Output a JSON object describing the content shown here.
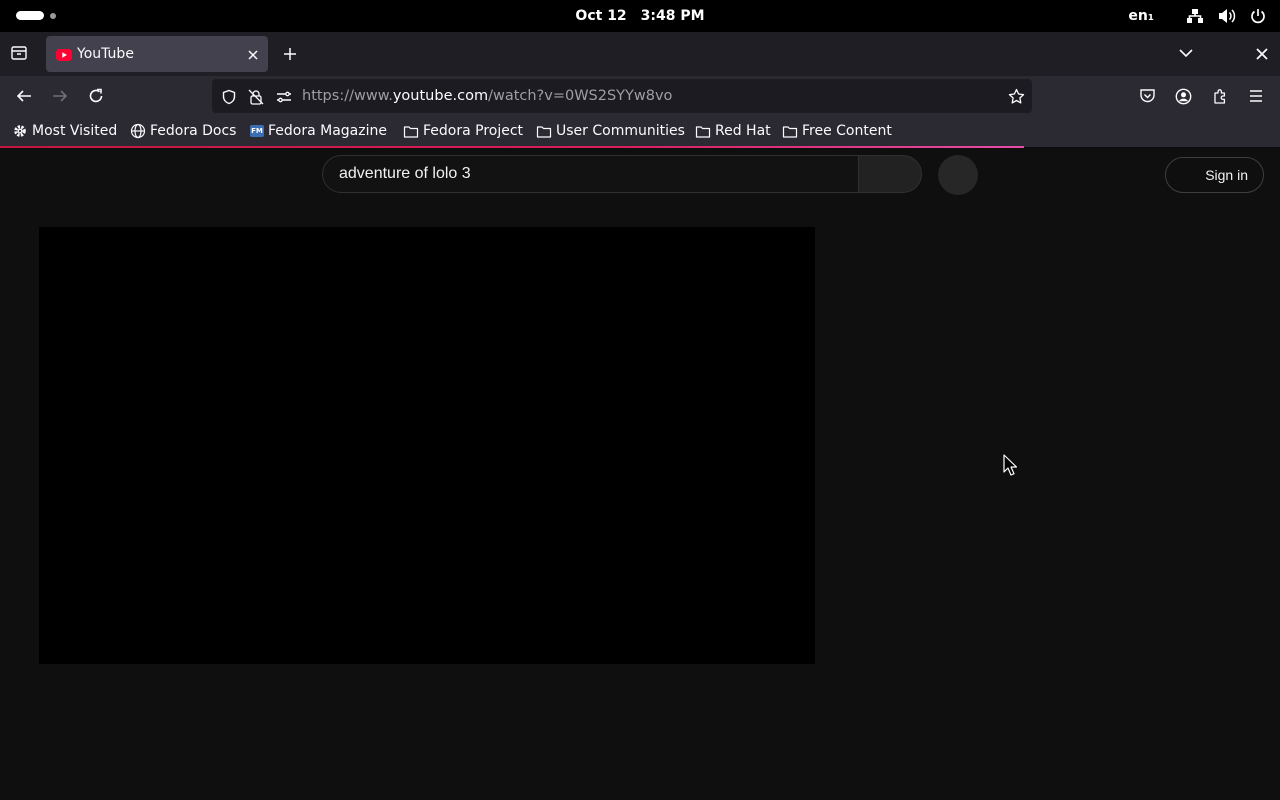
{
  "system_bar": {
    "date": "Oct 12",
    "time": "3:48 PM",
    "keyboard_layout": "en₁",
    "icons": [
      "network-icon",
      "volume-icon",
      "power-icon"
    ]
  },
  "browser": {
    "tab": {
      "title": "YouTube",
      "favicon": "youtube-icon"
    },
    "url": {
      "scheme": "https://www.",
      "host": "youtube.com",
      "path": "/watch?v=0WS2SYYw8vo"
    },
    "bookmarks": [
      {
        "label": "Most Visited",
        "icon": "gear-icon"
      },
      {
        "label": "Fedora Docs",
        "icon": "globe-icon"
      },
      {
        "label": "Fedora Magazine",
        "icon": "fedora-magazine-icon",
        "badge": "FM"
      },
      {
        "label": "Fedora Project",
        "icon": "folder-icon"
      },
      {
        "label": "User Communities",
        "icon": "folder-icon"
      },
      {
        "label": "Red Hat",
        "icon": "folder-icon"
      },
      {
        "label": "Free Content",
        "icon": "folder-icon"
      }
    ]
  },
  "youtube": {
    "search_query": "adventure of lolo 3",
    "sign_in_label": "Sign in"
  },
  "colors": {
    "page_background": "#0f0f0f",
    "video_background": "#000000",
    "loading_bar": "#d91d5e",
    "url_bar": "#1c1b22",
    "toolbar": "#2b2a33"
  }
}
